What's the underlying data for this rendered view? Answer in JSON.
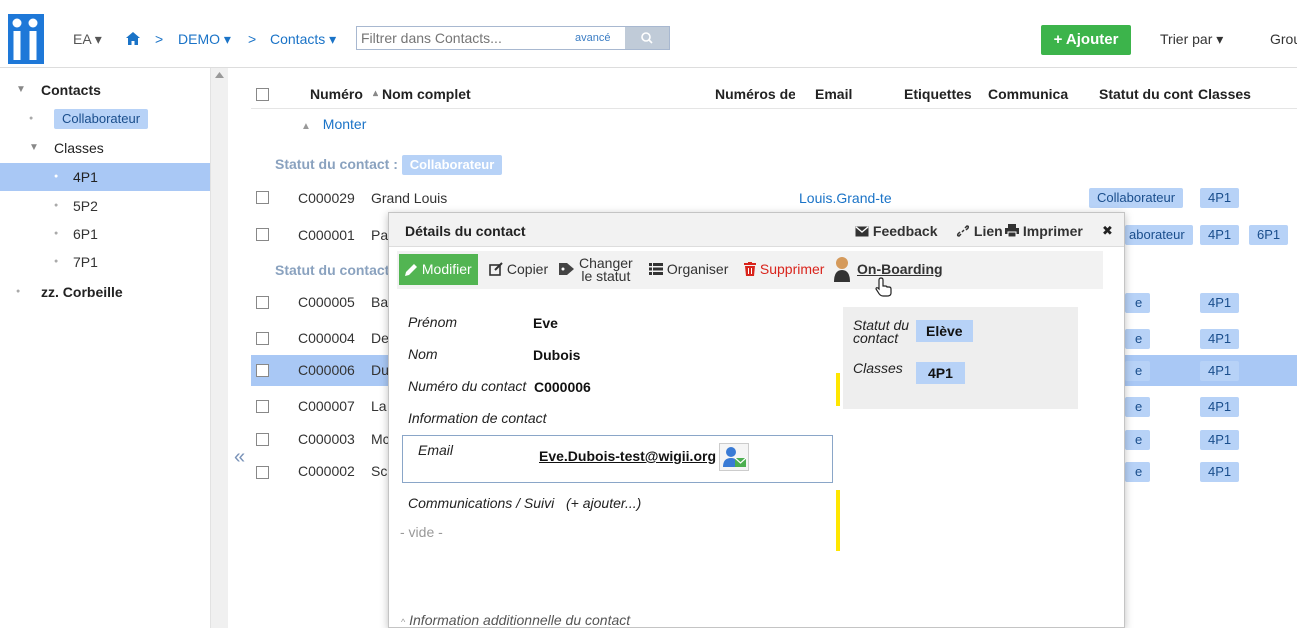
{
  "header": {
    "breadcrumb": {
      "ea": "EA",
      "ea_caret": "▾",
      "home_icon": "home-icon",
      "sep1": ">",
      "demo": "DEMO",
      "demo_caret": "▾",
      "sep2": ">",
      "contacts": "Contacts",
      "contacts_caret": "▾"
    },
    "filter_placeholder": "Filtrer dans Contacts...",
    "filter_advanced": "avancé",
    "add_label": "+ Ajouter",
    "sort_label": "Trier par",
    "sort_caret": "▾",
    "group_label": "Grou"
  },
  "sidebar": {
    "items": [
      {
        "label": "Contacts",
        "arrow": "▼"
      },
      {
        "label": "Collaborateur",
        "bullet": "●"
      },
      {
        "label": "Classes",
        "arrow": "▼"
      },
      {
        "label": "4P1",
        "bullet": "●"
      },
      {
        "label": "5P2",
        "bullet": "●"
      },
      {
        "label": "6P1",
        "bullet": "●"
      },
      {
        "label": "7P1",
        "bullet": "●"
      },
      {
        "label": "zz. Corbeille",
        "bullet": "●"
      }
    ],
    "collapse_icon": "«"
  },
  "list": {
    "columns": [
      "Numéro",
      "Nom complet",
      "Numéros de",
      "Email",
      "Etiquettes",
      "Communica",
      "Statut du conta",
      "Classes"
    ],
    "sort_indicator": "▴",
    "up_arrow": "▲",
    "up_label": "Monter",
    "group1_label": "Statut du contact :",
    "group1_tag": "Collaborateur",
    "group2_label": "Statut du contact",
    "rows": [
      {
        "num": "C000029",
        "name": "Grand Louis",
        "email": "Louis.Grand-te",
        "status": "Collaborateur",
        "classes": [
          "4P1"
        ]
      },
      {
        "num": "C000001",
        "name": "Pa",
        "email": "",
        "status": "aborateur",
        "classes": [
          "4P1",
          "6P1"
        ]
      },
      {
        "num": "C000005",
        "name": "Ba",
        "email": "",
        "status": "e",
        "classes": [
          "4P1"
        ]
      },
      {
        "num": "C000004",
        "name": "De",
        "email": "",
        "status": "e",
        "classes": [
          "4P1"
        ]
      },
      {
        "num": "C000006",
        "name": "Du",
        "email": "",
        "status": "e",
        "classes": [
          "4P1"
        ]
      },
      {
        "num": "C000007",
        "name": "La",
        "email": "",
        "status": "e",
        "classes": [
          "4P1"
        ]
      },
      {
        "num": "C000003",
        "name": "Mc",
        "email": "",
        "status": "e",
        "classes": [
          "4P1"
        ]
      },
      {
        "num": "C000002",
        "name": "Sc",
        "email": "",
        "status": "e",
        "classes": [
          "4P1"
        ]
      }
    ]
  },
  "popup": {
    "title": "Détails du contact",
    "feedback": "Feedback",
    "link": "Lien",
    "print": "Imprimer",
    "close": "✖",
    "toolbar": {
      "modify": "Modifier",
      "copy": "Copier",
      "change_status_1": "Changer",
      "change_status_2": "le statut",
      "organise": "Organiser",
      "delete": "Supprimer",
      "onboarding": "On-Boarding"
    },
    "fields": {
      "firstname_label": "Prénom",
      "firstname_value": "Eve",
      "lastname_label": "Nom",
      "lastname_value": "Dubois",
      "number_label": "Numéro du contact",
      "number_value": "C000006",
      "contact_info_label": "Information de contact",
      "email_label": "Email",
      "email_value": "Eve.Dubois-test@wigii.org",
      "comms_label": "Communications / Suivi",
      "comms_add": "(+ ajouter...)",
      "empty": "- vide -",
      "additional": "Information additionnelle du contact",
      "status_label_1": "Statut du",
      "status_label_2": "contact",
      "status_value": "Elève",
      "classes_label": "Classes",
      "classes_value": "4P1"
    }
  },
  "colors": {
    "accent": "#3cb44b",
    "link": "#1a73c7",
    "selection": "#a9c8f5",
    "tag": "#b7d2f7",
    "delete": "#d9241c",
    "highlight": "#ffe600"
  }
}
